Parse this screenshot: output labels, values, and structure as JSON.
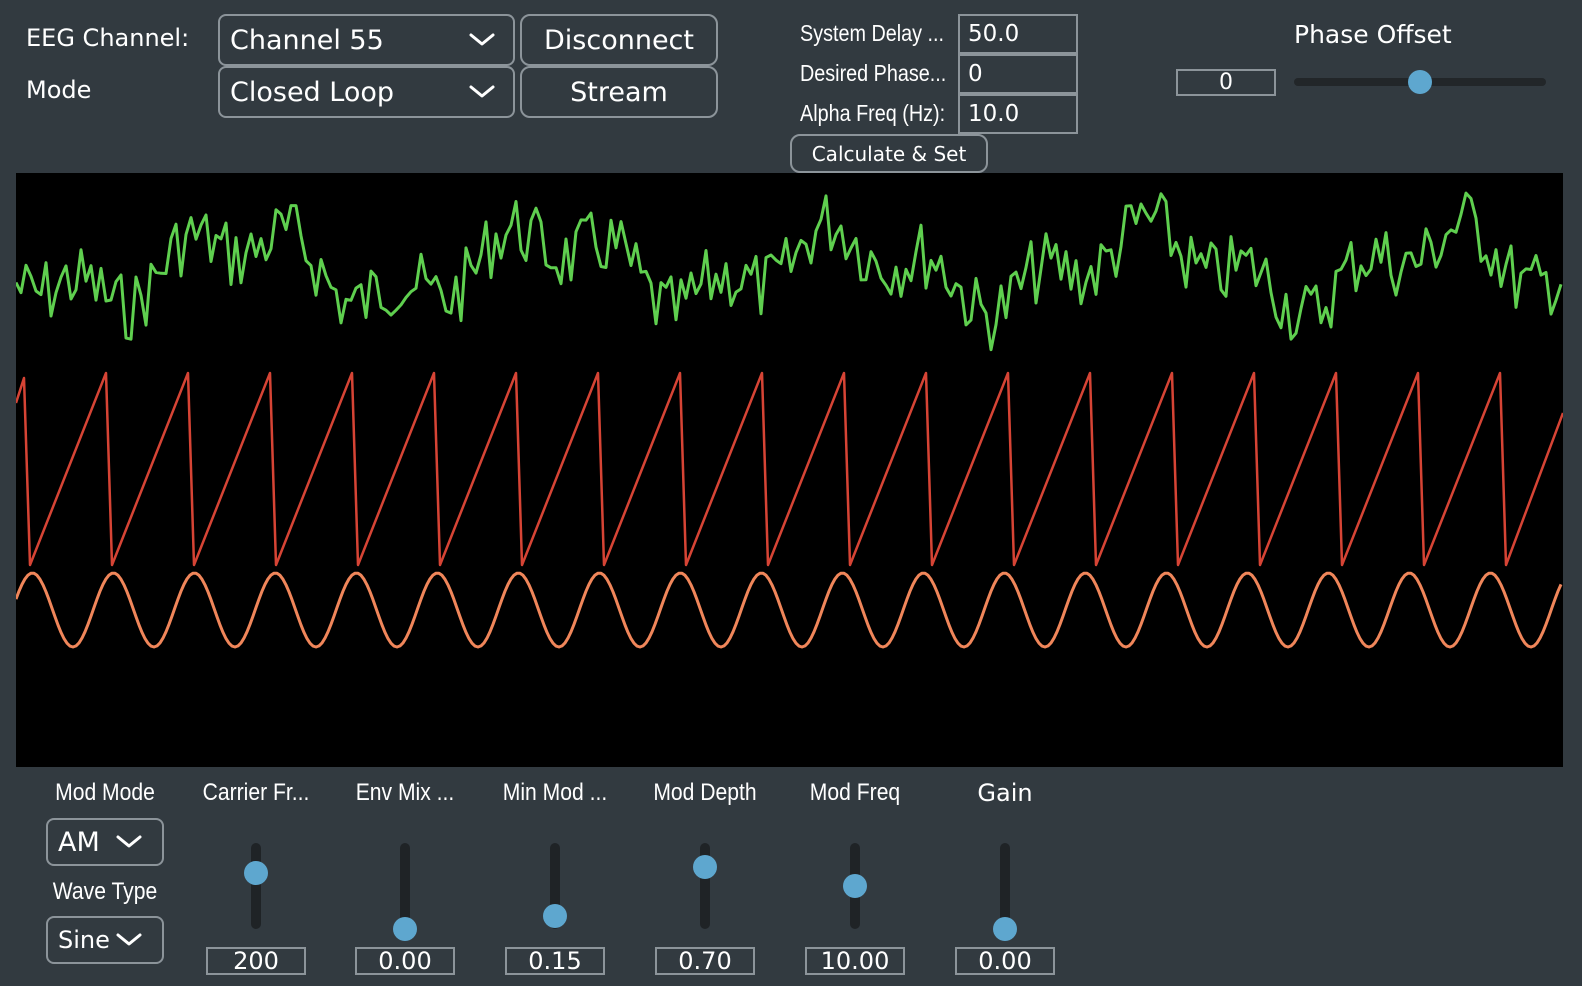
{
  "header": {
    "eeg_channel_label": "EEG Channel:",
    "mode_label": "Mode",
    "channel_select": "Channel 55",
    "mode_select": "Closed Loop",
    "disconnect_label": "Disconnect",
    "stream_label": "Stream"
  },
  "params": {
    "system_delay_label": "System Delay ...",
    "system_delay_value": "50.0",
    "desired_phase_label": "Desired Phase...",
    "desired_phase_value": "0",
    "alpha_freq_label": "Alpha Freq (Hz):",
    "alpha_freq_value": "10.0",
    "calculate_label": "Calculate & Set"
  },
  "phase_offset": {
    "label": "Phase Offset",
    "value": "0",
    "slider_fraction": 0.5
  },
  "scope": {
    "colors": {
      "eeg": "#5fcf4f",
      "phase": "#d64435",
      "sine": "#f0865a"
    }
  },
  "bottom": {
    "mod_mode_label": "Mod Mode",
    "mod_mode_value": "AM",
    "wave_type_label": "Wave Type",
    "wave_type_value": "Sine",
    "sliders": [
      {
        "label": "Carrier Fr...",
        "value": "200",
        "fraction": 0.65
      },
      {
        "label": "Env Mix ...",
        "value": "0.00",
        "fraction": 0.0
      },
      {
        "label": "Min Mod ...",
        "value": "0.15",
        "fraction": 0.15
      },
      {
        "label": "Mod Depth",
        "value": "0.70",
        "fraction": 0.72
      },
      {
        "label": "Mod Freq",
        "value": "10.00",
        "fraction": 0.5
      },
      {
        "label": "Gain",
        "value": "0.00",
        "fraction": 0.0
      }
    ]
  },
  "colors": {
    "background": "#323a40",
    "accent": "#5ea7cf",
    "border": "#8c949a"
  }
}
